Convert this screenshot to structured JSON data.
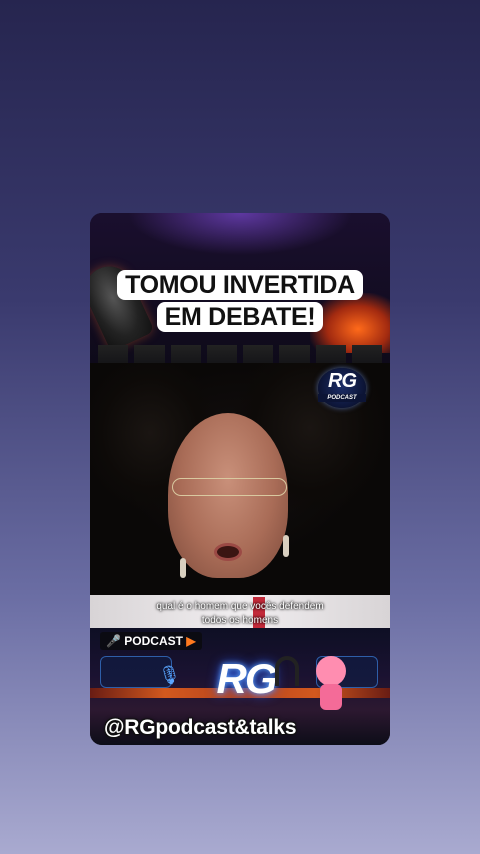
{
  "video": {
    "headline_line1": "TOMOU INVERTIDA",
    "headline_line2": "EM DEBATE!",
    "subtitle_line1": "qual é o homem que vocês defendem",
    "subtitle_line2": "todos os homens",
    "badge_logo": "RG",
    "badge_caption": "PODCAST",
    "footer_tag": "PODCAST",
    "footer_logo": "RG",
    "handle": "@RGpodcast&talks"
  },
  "colors": {
    "accent_orange": "#ff6a1a",
    "accent_blue": "#5aa6ff",
    "background_top": "#26254f",
    "background_bottom": "#a9aad0"
  },
  "icons": {
    "footer_tag_mic": "microphone-icon",
    "footer_tag_play": "play-icon",
    "footer_mic": "microphone-icon"
  }
}
